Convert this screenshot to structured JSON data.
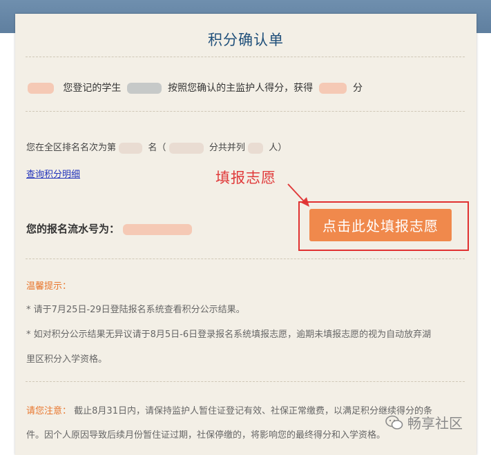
{
  "card": {
    "title": "积分确认单"
  },
  "summary": {
    "part1": "您登记的学生",
    "part2": "按照您确认的主监护人得分，获得",
    "part3": "分"
  },
  "ranking": {
    "part1": "您在全区排名名次为第",
    "part2": "名（",
    "part3": "分共并列",
    "part4": "人）"
  },
  "links": {
    "query_points_detail": "查询积分明细"
  },
  "annotation": {
    "text": "填报志愿"
  },
  "registration": {
    "label": "您的报名流水号为："
  },
  "cta": {
    "label": "点击此处填报志愿"
  },
  "tips": {
    "heading": "温馨提示：",
    "line1": "* 请于7月25日-29日登陆报名系统查看积分公示结果。",
    "line2a": "* 如对积分公示结果无异议请于8月5日-6日登录报名系统填报志愿，逾期未填报志愿的视为自动放弃湖",
    "line2b": "里区积分入学资格。"
  },
  "notice": {
    "heading": "请您注意：",
    "line1": "截止8月31日内，请保持监护人暂住证登记有效、社保正常缴费，以满足积分继续得分的条",
    "line2": "件。因个人原因导致后续月份暂住证过期，社保停缴的，将影响您的最终得分和入学资格。"
  },
  "watermark": {
    "text": "畅享社区"
  },
  "colors": {
    "accent": "#f0894c",
    "title": "#1f4f7a",
    "annotation": "#e03a3a",
    "tip": "#e8762d"
  }
}
